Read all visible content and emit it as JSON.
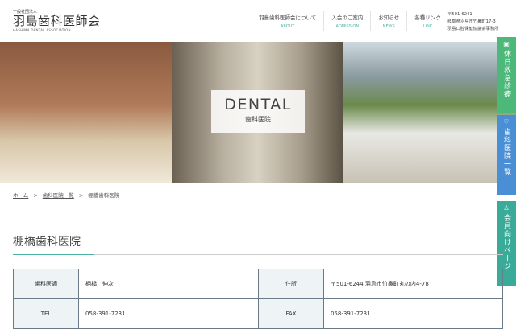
{
  "header": {
    "logo_small": "一般社団法人",
    "logo_name": "羽島歯科医師会",
    "logo_en": "HASHIMA DENTAL ASSOCIATION",
    "nav": [
      {
        "jp": "羽島歯科医師会について",
        "en": "ABOUT"
      },
      {
        "jp": "入会のご案内",
        "en": "ADMISSION"
      },
      {
        "jp": "お知らせ",
        "en": "NEWS"
      },
      {
        "jp": "各種リンク",
        "en": "LINK"
      }
    ],
    "address": [
      "〒501-6241",
      "岐阜県羽島市竹鼻町17-3",
      "羽島口腔保健協議会事務所"
    ]
  },
  "hero": {
    "title": "DENTAL",
    "subtitle": "歯科医院"
  },
  "side_tabs": [
    {
      "label": "休日救急診療",
      "icon": "hospital-icon",
      "color": "#4cb87a"
    },
    {
      "label": "歯科医院一覧",
      "icon": "tooth-icon",
      "color": "#4a8fd6"
    },
    {
      "label": "会員向けページ",
      "icon": "person-icon",
      "color": "#3aab98"
    }
  ],
  "breadcrumb": {
    "home": "ホーム",
    "list": "歯科医院一覧",
    "current": "棚橋歯科医院",
    "sep": ">"
  },
  "page_title": "棚橋歯科医院",
  "info": {
    "rows": [
      {
        "l1": "歯科医師",
        "v1": "棚橋　伸次",
        "l2": "住所",
        "v2": "〒501-6244 羽島市竹鼻町丸の内4-78"
      },
      {
        "l1": "TEL",
        "v1": "058-391-7231",
        "l2": "FAX",
        "v2": "058-391-7231"
      }
    ]
  }
}
